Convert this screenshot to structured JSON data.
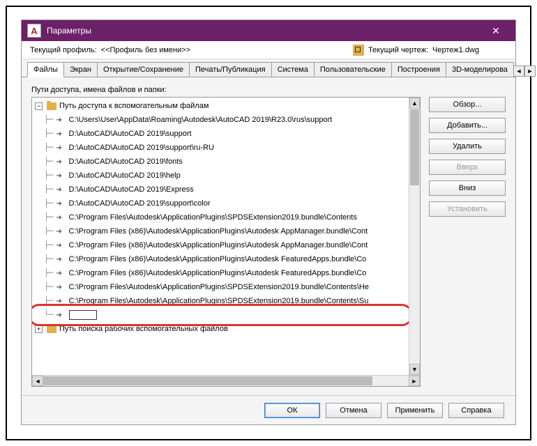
{
  "window": {
    "title": "Параметры",
    "app_letter": "A"
  },
  "info": {
    "current_profile_label": "Текущий профиль:",
    "current_profile_value": "<<Профиль без имени>>",
    "current_drawing_label": "Текущий чертеж:",
    "current_drawing_value": "Чертеж1.dwg"
  },
  "tabs": [
    "Файлы",
    "Экран",
    "Открытие/Сохранение",
    "Печать/Публикация",
    "Система",
    "Пользовательские",
    "Построения",
    "3D-моделирова"
  ],
  "active_tab": 0,
  "section_label": "Пути доступа, имена файлов и папки:",
  "tree": {
    "root_label": "Путь доступа к вспомогательным файлам",
    "paths": [
      "C:\\Users\\User\\AppData\\Roaming\\Autodesk\\AutoCAD 2019\\R23.0\\rus\\support",
      "D:\\AutoCAD\\AutoCAD 2019\\support",
      "D:\\AutoCAD\\AutoCAD 2019\\support\\ru-RU",
      "D:\\AutoCAD\\AutoCAD 2019\\fonts",
      "D:\\AutoCAD\\AutoCAD 2019\\help",
      "D:\\AutoCAD\\AutoCAD 2019\\Express",
      "D:\\AutoCAD\\AutoCAD 2019\\support\\color",
      "C:\\Program Files\\Autodesk\\ApplicationPlugins\\SPDSExtension2019.bundle\\Contents",
      "C:\\Program Files (x86)\\Autodesk\\ApplicationPlugins\\Autodesk AppManager.bundle\\Cont",
      "C:\\Program Files (x86)\\Autodesk\\ApplicationPlugins\\Autodesk AppManager.bundle\\Cont",
      "C:\\Program Files (x86)\\Autodesk\\ApplicationPlugins\\Autodesk FeaturedApps.bundle\\Co",
      "C:\\Program Files (x86)\\Autodesk\\ApplicationPlugins\\Autodesk FeaturedApps.bundle\\Co",
      "C:\\Program Files\\Autodesk\\ApplicationPlugins\\SPDSExtension2019.bundle\\Contents\\He",
      "C:\\Program Files\\Autodesk\\ApplicationPlugins\\SPDSExtension2019.bundle\\Contents\\Su"
    ],
    "edit_value": "",
    "next_root_label": "Путь поиска рабочих вспомогательных файлов"
  },
  "side_buttons": {
    "browse": "Обзор...",
    "add": "Добавить...",
    "delete": "Удалить",
    "up": "Вверх",
    "down": "Вниз",
    "set_default": "Установить"
  },
  "bottom_buttons": {
    "ok": "ОК",
    "cancel": "Отмена",
    "apply": "Применить",
    "help": "Справка"
  }
}
